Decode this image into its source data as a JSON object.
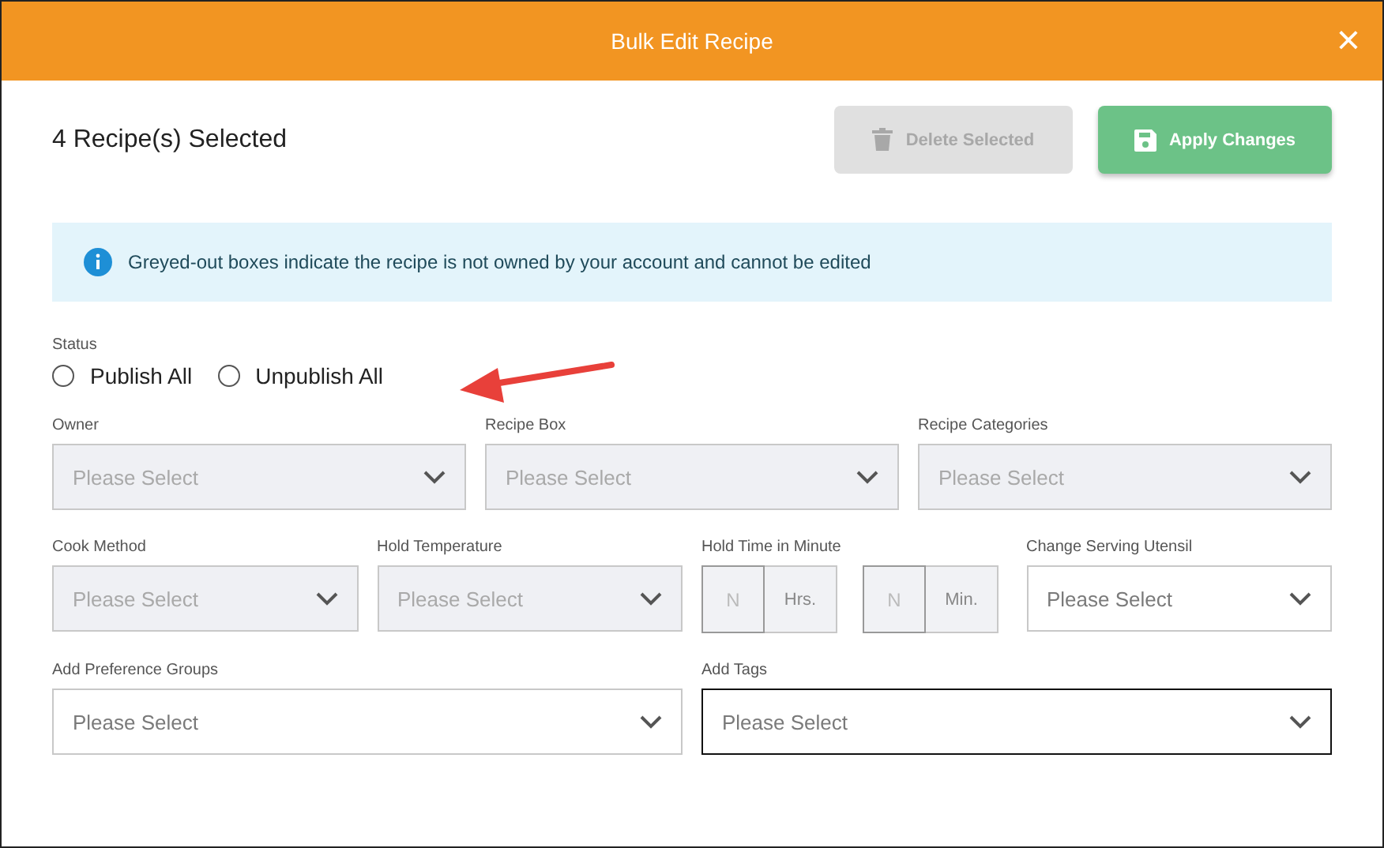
{
  "dialog": {
    "title": "Bulk Edit Recipe",
    "close": "×"
  },
  "selection_count": "4 Recipe(s) Selected",
  "buttons": [
    {
      "label": "Delete Selected",
      "kind": "delete",
      "disabled": true
    },
    {
      "label": "Apply Changes",
      "kind": "apply",
      "disabled": false
    }
  ],
  "notice": "Greyed-out boxes indicate the recipe is not owned by your account and cannot be edited",
  "status": {
    "label": "Status",
    "options": [
      {
        "label": "Publish All",
        "selected": false
      },
      {
        "label": "Unpublish All",
        "selected": false
      }
    ]
  },
  "field_rows": [
    [
      {
        "kind": "select",
        "label": "Owner",
        "placeholder": "Please Select",
        "disabled": true
      },
      {
        "kind": "select",
        "label": "Recipe Box",
        "placeholder": "Please Select",
        "disabled": true
      },
      {
        "kind": "select",
        "label": "Recipe Categories",
        "placeholder": "Please Select",
        "disabled": true
      }
    ],
    [
      {
        "kind": "select",
        "label": "Cook Method",
        "placeholder": "Please Select",
        "disabled": true
      },
      {
        "kind": "select",
        "label": "Hold Temperature",
        "placeholder": "Please Select",
        "disabled": true
      },
      {
        "kind": "time",
        "label": "Hold Time in Minute",
        "parts": [
          {
            "placeholder": "N",
            "unit": "Hrs."
          },
          {
            "placeholder": "N",
            "unit": "Min."
          }
        ],
        "disabled": true
      },
      {
        "kind": "select",
        "label": "Change Serving Utensil",
        "placeholder": "Please Select",
        "disabled": false
      }
    ],
    [
      {
        "kind": "select",
        "label": "Add Preference Groups",
        "placeholder": "Please Select",
        "disabled": false
      },
      {
        "kind": "select",
        "label": "Add Tags",
        "placeholder": "Please Select",
        "disabled": false,
        "focused": true
      }
    ]
  ]
}
